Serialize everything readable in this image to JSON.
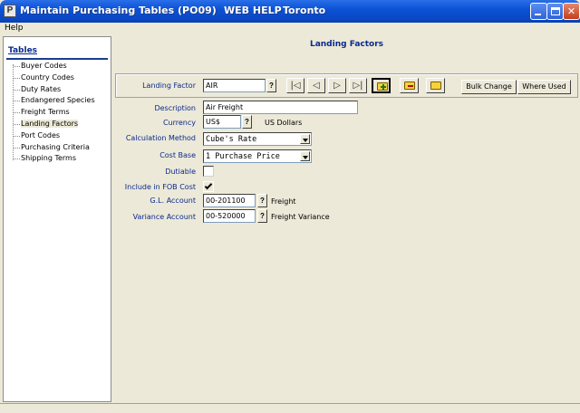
{
  "window": {
    "app_icon_label": "P",
    "title": "Maintain Purchasing Tables (PO09)",
    "web_help": "WEB HELP",
    "location": "Toronto"
  },
  "menu": {
    "help": "Help"
  },
  "sidebar": {
    "heading": "Tables",
    "items": [
      {
        "label": "Buyer Codes"
      },
      {
        "label": "Country Codes"
      },
      {
        "label": "Duty Rates"
      },
      {
        "label": "Endangered Species"
      },
      {
        "label": "Freight Terms"
      },
      {
        "label": "Landing Factors"
      },
      {
        "label": "Port Codes"
      },
      {
        "label": "Purchasing Criteria"
      },
      {
        "label": "Shipping Terms"
      }
    ],
    "selected": "Landing Factors"
  },
  "main": {
    "title": "Landing Factors",
    "toolbar": {
      "landing_factor_label": "Landing Factor",
      "landing_factor_value": "AIR",
      "lookup": "?",
      "nav_first": "|◁",
      "nav_prev": "◁",
      "nav_next": "▷",
      "nav_last": "▷|",
      "bulk_change": "Bulk Change",
      "where_used": "Where Used"
    },
    "form": {
      "description_label": "Description",
      "description_value": "Air Freight",
      "currency_label": "Currency",
      "currency_value": "US$",
      "currency_desc": "US Dollars",
      "calc_method_label": "Calculation Method",
      "calc_method_value": "Cube's Rate",
      "cost_base_label": "Cost Base",
      "cost_base_value": "1 Purchase Price",
      "dutiable_label": "Dutiable",
      "dutiable_checked": false,
      "include_fob_label": "Include in FOB Cost",
      "include_fob_checked": true,
      "gl_account_label": "G.L. Account",
      "gl_account_value": "00-201100",
      "gl_account_desc": "Freight",
      "variance_account_label": "Variance Account",
      "variance_account_value": "00-520000",
      "variance_account_desc": "Freight Variance",
      "lookup": "?"
    }
  },
  "colors": {
    "titlebar": "#0b52d6",
    "label_blue": "#0a2a8e",
    "face": "#ece9d8"
  }
}
